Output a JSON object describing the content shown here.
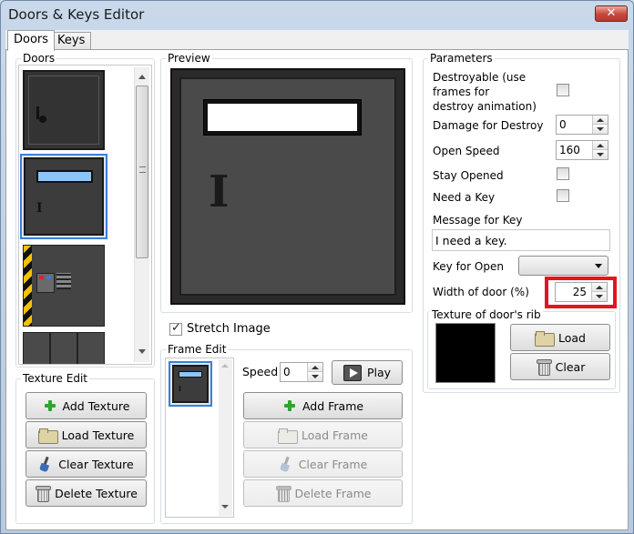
{
  "window": {
    "title": "Doors & Keys Editor",
    "close_glyph": "✕"
  },
  "tabs": [
    {
      "label": "Doors"
    },
    {
      "label": "Keys"
    }
  ],
  "doors_group": {
    "title": "Doors",
    "selected_index": 1
  },
  "texture_edit": {
    "title": "Texture Edit",
    "add_label": "Add Texture",
    "load_label": "Load Texture",
    "clear_label": "Clear Texture",
    "delete_label": "Delete Texture"
  },
  "preview": {
    "title": "Preview",
    "door_letter": "I"
  },
  "stretch_image": {
    "label": "Stretch Image",
    "checked": true,
    "check_glyph": "✓"
  },
  "frame_edit": {
    "title": "Frame Edit",
    "speed_label": "Speed",
    "speed_value": "0",
    "play_label": "Play",
    "add_label": "Add Frame",
    "load_label": "Load Frame",
    "clear_label": "Clear Frame",
    "delete_label": "Delete Frame",
    "frame_letter": "I"
  },
  "parameters": {
    "title": "Parameters",
    "destroyable_label_1": "Destroyable (use",
    "destroyable_label_2": "frames for",
    "destroyable_label_3": "destroy animation)",
    "damage_label": "Damage for Destroy",
    "damage_value": "0",
    "open_speed_label": "Open Speed",
    "open_speed_value": "160",
    "stay_opened_label": "Stay Opened",
    "need_key_label": "Need a Key",
    "message_label": "Message for Key",
    "message_value": "I need a key.",
    "key_for_open_label": "Key for Open",
    "width_label": "Width of door (%)",
    "width_value": "25",
    "rib_title": "Texture of door's rib",
    "rib_load_label": "Load",
    "rib_clear_label": "Clear"
  },
  "colors": {
    "highlight_border": "#e3141e",
    "selection_border": "#3b7fd8",
    "door_panel_light": "#8ec5f5"
  }
}
